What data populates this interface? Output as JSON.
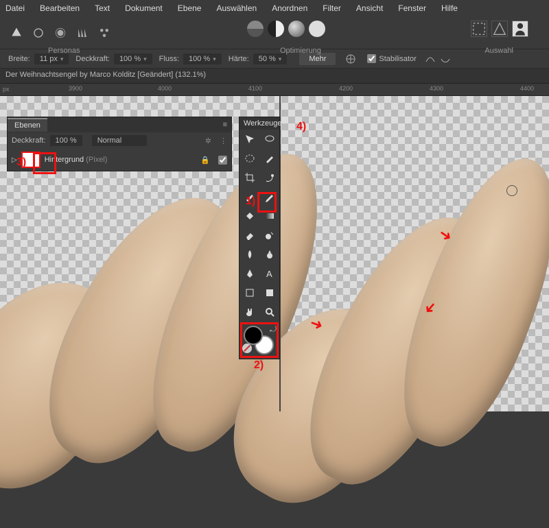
{
  "menu": {
    "items": [
      "Datei",
      "Bearbeiten",
      "Text",
      "Dokument",
      "Ebene",
      "Auswählen",
      "Anordnen",
      "Filter",
      "Ansicht",
      "Fenster",
      "Hilfe"
    ]
  },
  "toolbar_groups": {
    "personas": "Personas",
    "optimierung": "Optimierung",
    "auswahl": "Auswahl"
  },
  "options": {
    "breite_label": "Breite:",
    "breite_value": "11 px",
    "deckkraft_label": "Deckkraft:",
    "deckkraft_value": "100 %",
    "fluss_label": "Fluss:",
    "fluss_value": "100 %",
    "haerte_label": "Härte:",
    "haerte_value": "50 %",
    "mehr": "Mehr",
    "stabilisator": "Stabilisator"
  },
  "document_title": "Der Weihnachtsengel by Marco Kolditz [Geändert] (132.1%)",
  "ruler": {
    "unit": "px",
    "ticks": [
      "3900",
      "4000",
      "4100",
      "4200",
      "4300",
      "4400"
    ]
  },
  "layers": {
    "tab": "Ebenen",
    "deckkraft_label": "Deckkraft:",
    "deckkraft_value": "100 %",
    "blend_mode": "Normal",
    "layer0": {
      "name": "Hintergrund",
      "type": "(Pixel)"
    }
  },
  "tools": {
    "title": "Werkzeuge"
  },
  "annotations": {
    "step1": "1)",
    "step2": "2)",
    "step3": "3)",
    "step4": "4)"
  }
}
